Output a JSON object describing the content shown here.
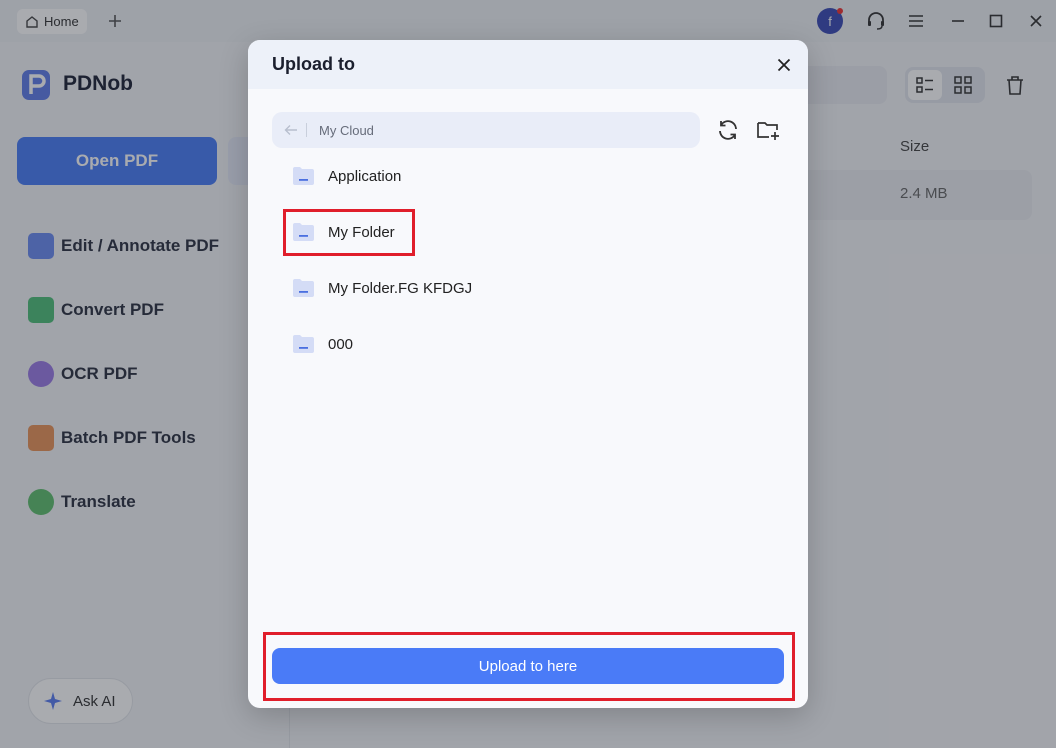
{
  "titlebar": {
    "tab_home_label": "Home",
    "avatar_letter": "f"
  },
  "sidebar": {
    "app_name": "PDNob",
    "open_pdf_label": "Open PDF",
    "items": [
      {
        "label": "Edit / Annotate PDF",
        "icon": "edit-icon"
      },
      {
        "label": "Convert PDF",
        "icon": "convert-icon"
      },
      {
        "label": "OCR PDF",
        "icon": "ocr-icon"
      },
      {
        "label": "Batch PDF Tools",
        "icon": "batch-icon"
      },
      {
        "label": "Translate",
        "icon": "translate-icon"
      }
    ],
    "ask_ai_label": "Ask AI"
  },
  "main": {
    "column_size": "Size",
    "file_size": "2.4 MB"
  },
  "dialog": {
    "title": "Upload to",
    "path": "My Cloud",
    "folders": [
      {
        "name": "Application"
      },
      {
        "name": "My Folder"
      },
      {
        "name": "My Folder.FG KFDGJ"
      },
      {
        "name": "000"
      }
    ],
    "upload_label": "Upload to here"
  },
  "colors": {
    "accent": "#4a7bf7",
    "highlight": "#e01e2b"
  }
}
